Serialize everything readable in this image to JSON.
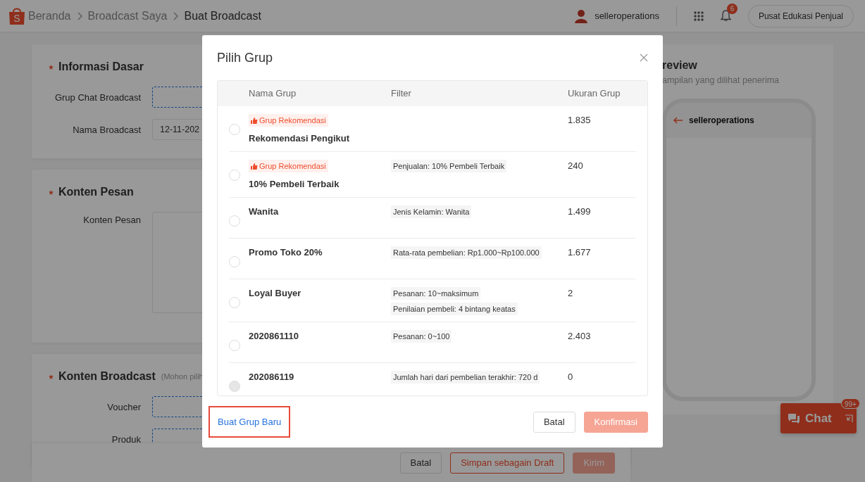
{
  "topbar": {
    "logo_letter": "S",
    "breadcrumb": [
      {
        "label": "Beranda",
        "current": false
      },
      {
        "label": "Broadcast Saya",
        "current": false
      },
      {
        "label": "Buat Broadcast",
        "current": true
      }
    ],
    "username": "selleroperations",
    "notification_count": "6",
    "help_button": "Pusat Edukasi Penjual"
  },
  "form_sections": [
    {
      "title": "Informasi Dasar",
      "required": true,
      "fields": [
        {
          "label": "Grup Chat Broadcast",
          "kind": "picker"
        },
        {
          "label": "Nama Broadcast",
          "kind": "text",
          "value": "12-11-202"
        }
      ]
    },
    {
      "title": "Konten Pesan",
      "required": true,
      "fields": [
        {
          "label": "Konten Pesan",
          "kind": "textarea"
        }
      ]
    },
    {
      "title": "Konten Broadcast",
      "required": true,
      "hint": "(Mohon pilih",
      "fields": [
        {
          "label": "Voucher",
          "kind": "picker"
        },
        {
          "label": "Produk",
          "kind": "picker"
        }
      ]
    }
  ],
  "action_bar": {
    "buttons": [
      {
        "label": "Batal",
        "kind": "default",
        "disabled": false
      },
      {
        "label": "Simpan sebagain Draft",
        "kind": "outline",
        "disabled": false
      },
      {
        "label": "Kirim",
        "kind": "primary",
        "disabled": true
      }
    ]
  },
  "preview": {
    "title": "review",
    "subtitle": "ampilan yang dilihat penerima",
    "chat_name": "selleroperations"
  },
  "chat_widget": {
    "label": "Chat",
    "badge": "99+"
  },
  "dialog": {
    "title": "Pilih Grup",
    "columns": [
      "Nama Grup",
      "Filter",
      "Ukuran Grup"
    ],
    "rows": [
      {
        "selected": false,
        "disabled": false,
        "tag": "Grup Rekomendasi",
        "name": "Rekomendasi Pengikut",
        "size": "1.835"
      },
      {
        "selected": false,
        "disabled": false,
        "tag": "Grup Rekomendasi",
        "name": "10% Pembeli Terbaik",
        "filters": [
          "Penjualan: 10% Pembeli Terbaik"
        ],
        "size": "240"
      },
      {
        "selected": false,
        "disabled": false,
        "name": "Wanita",
        "filters": [
          "Jenis Kelamin: Wanita"
        ],
        "size": "1.499"
      },
      {
        "selected": false,
        "disabled": false,
        "name": "Promo Toko 20%",
        "filters": [
          "Rata-rata pembelian: Rp1.000~Rp100.000"
        ],
        "size": "1.677"
      },
      {
        "selected": false,
        "disabled": false,
        "name": "Loyal Buyer",
        "filters": [
          "Pesanan: 10~maksimum",
          "Penilaian pembeli: 4 bintang keatas"
        ],
        "size": "2"
      },
      {
        "selected": false,
        "disabled": false,
        "name": "2020861110",
        "filters": [
          "Pesanan: 0~100"
        ],
        "size": "2.403"
      },
      {
        "selected": false,
        "disabled": true,
        "name": "202086119",
        "filters": [
          "Jumlah hari dari pembelian terakhir: 720 d"
        ],
        "size": "0"
      }
    ],
    "create_link": {
      "label": "Buat Grup Baru",
      "highlighted": true
    },
    "cancel_button": "Batal",
    "confirm_button": {
      "label": "Konfirmasi",
      "disabled": true
    }
  }
}
